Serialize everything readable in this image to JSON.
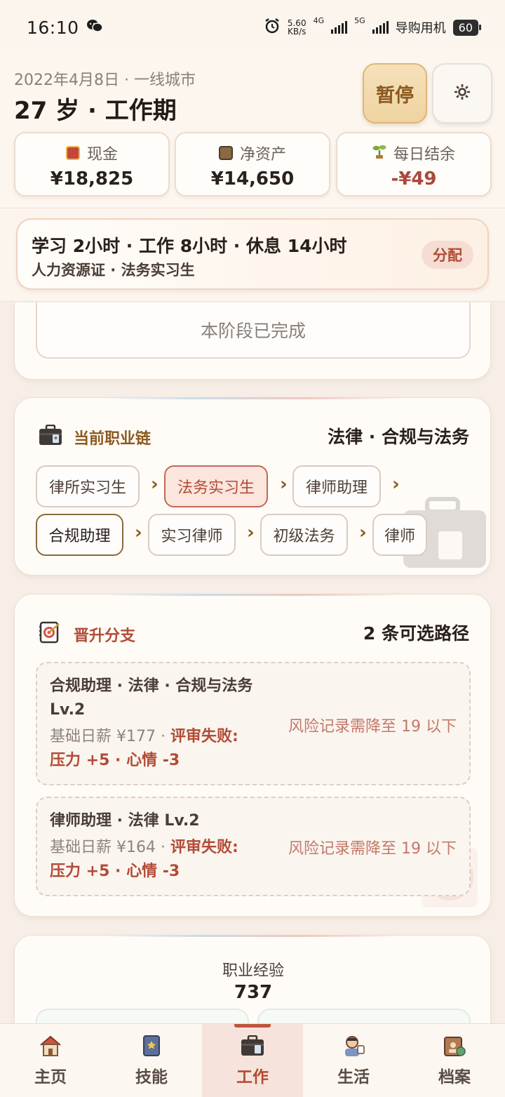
{
  "status_bar": {
    "time": "16:10",
    "speed_top": "5.60",
    "speed_bottom": "KB/s",
    "net1": "4G",
    "net2": "5G",
    "carrier": "导购用机",
    "battery": "60"
  },
  "header": {
    "date_line": "2022年4月8日 · 一线城市",
    "age_line": "27 岁 · 工作期",
    "pause_label": "暂停",
    "settings_icon": "gear-icon"
  },
  "stats": [
    {
      "label": "现金",
      "value": "¥18,825",
      "icon": "wallet-icon"
    },
    {
      "label": "净资产",
      "value": "¥14,650",
      "icon": "building-icon"
    },
    {
      "label": "每日结余",
      "value": "-¥49",
      "icon": "sprout-icon"
    }
  ],
  "allocation": {
    "line1": "学习 2小时 · 工作 8小时 · 休息 14小时",
    "line2": "人力资源证 · 法务实习生",
    "button": "分配"
  },
  "stage_card": {
    "done_label": "本阶段已完成"
  },
  "career_chain": {
    "title": "当前职业链",
    "field": "法律 · 合规与法务",
    "nodes": [
      "律所实习生",
      "法务实习生",
      "律师助理",
      "合规助理",
      "实习律师",
      "初级法务",
      "律师"
    ],
    "arrow": "›"
  },
  "promotion": {
    "title": "晋升分支",
    "count_label": "2 条可选路径",
    "branches": [
      {
        "title_a": "合规助理 · 法律 · 合规与法务",
        "title_b": "Lv.2",
        "salary": "基础日薪 ¥177 · ",
        "fail_a": "评审失败:",
        "fail_b": "压力 +5 · 心情 -3",
        "risk": "风险记录需降至 19 以下"
      },
      {
        "title_a": "律师助理 · 法律 Lv.2",
        "salary": "基础日薪 ¥164 · ",
        "fail_a": "评审失败:",
        "fail_b": "压力 +5 · 心情 -3",
        "risk": "风险记录需降至 19 以下"
      }
    ]
  },
  "experience": {
    "label": "职业经验",
    "value": "737"
  },
  "nav": [
    {
      "label": "主页",
      "icon": "house-icon",
      "active": false
    },
    {
      "label": "技能",
      "icon": "book-icon",
      "active": false
    },
    {
      "label": "工作",
      "icon": "briefcase-icon",
      "active": true
    },
    {
      "label": "生活",
      "icon": "person-icon",
      "active": false
    },
    {
      "label": "档案",
      "icon": "folder-icon",
      "active": false
    }
  ],
  "colors": {
    "accent": "#b24b36",
    "gold": "#8b5a20",
    "background": "#f7efe7"
  }
}
